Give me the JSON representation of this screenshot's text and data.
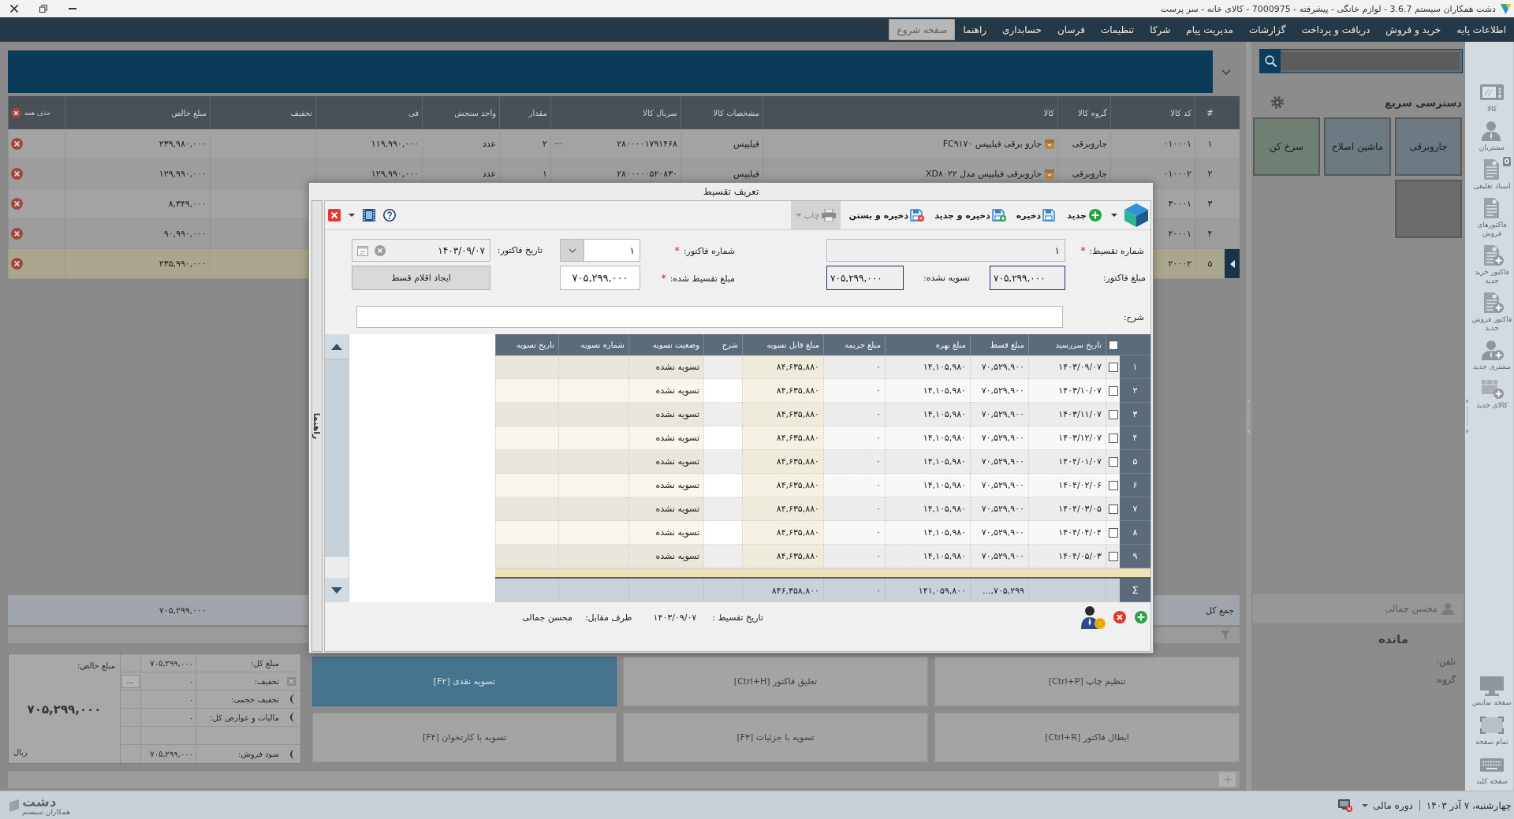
{
  "window": {
    "title": "دشت همکاران سیستم 3.6.7 - لوازم خانگی - پیشرفته - 7000975 - کالای خانه - سر پرست"
  },
  "menu": [
    {
      "label": "اطلاعات پایه",
      "selected": false
    },
    {
      "label": "خرید و فروش",
      "selected": false
    },
    {
      "label": "دریافت و پرداخت",
      "selected": false
    },
    {
      "label": "گزارشات",
      "selected": false
    },
    {
      "label": "مدیریت پیام",
      "selected": false
    },
    {
      "label": "شرکا",
      "selected": false
    },
    {
      "label": "تنظیمات",
      "selected": false
    },
    {
      "label": "فرسان",
      "selected": false
    },
    {
      "label": "حسابداری",
      "selected": false
    },
    {
      "label": "راهنما",
      "selected": false
    },
    {
      "label": "صفحه شروع",
      "selected": true
    }
  ],
  "sidebar": {
    "items": [
      {
        "kind": "product",
        "label": "کالا"
      },
      {
        "kind": "customers",
        "label": "مشتریان"
      },
      {
        "kind": "suspended",
        "label": "اسناد تعلیقی",
        "badge": "0"
      },
      {
        "kind": "invoices",
        "label": "فاکتورهای فروش"
      },
      {
        "kind": "new_purchase",
        "label": "فاکتور خرید جدید"
      },
      {
        "kind": "new_sale",
        "label": "فاکتور فروش جدید"
      },
      {
        "kind": "new_customer",
        "label": "مشتری جدید"
      },
      {
        "kind": "new_product",
        "label": "کالای جدید"
      }
    ],
    "bottom_items": [
      {
        "kind": "display",
        "label": "صفحه نمایش"
      },
      {
        "kind": "fullscreen",
        "label": "تمام صفحه"
      },
      {
        "kind": "keyboard",
        "label": "صفحه کلید"
      }
    ]
  },
  "quick_access": {
    "title": "دسترسی سریع",
    "tiles": [
      {
        "label": "جاروبرقی",
        "color": "#6e7a83"
      },
      {
        "label": "ماشین اصلاح",
        "color": "#6c7a81"
      },
      {
        "label": "سرخ کن",
        "color": "#6f7f74"
      },
      {
        "color": "#6b6b6b"
      }
    ]
  },
  "customer": {
    "name": "محسن جمالی",
    "balance_title": "مانده",
    "phone_label": "تلفن:",
    "group_label": "گروه:"
  },
  "items_table": {
    "columns": [
      "#",
      "کد کالا",
      "گروه کالا",
      "کالا",
      "مشخصات کالا",
      "سریال کالا",
      "مقدار",
      "واحد سنجش",
      "فی",
      "تخفیف",
      "مبلغ خالص",
      "حذف همه"
    ],
    "rows": [
      {
        "index": "۱",
        "code": "۰۱۰۰۰۱",
        "group": "جاروبرقی",
        "product": "جارو برقی فیلیپس FC۹۱۷۰",
        "brand": "فیلیپس",
        "serial": "۲۸۰۰۰۰۱۷۹۱۴۶۸",
        "more": "...",
        "qty": "۲",
        "unit": "عدد",
        "price": "۱۱۹,۹۹۰,۰۰۰",
        "net": "۲۳۹,۹۸۰,۰۰۰",
        "selected": false
      },
      {
        "index": "۲",
        "code": "۰۱۰۰۰۲",
        "group": "جاروبرقی",
        "product": "جاروبرقی فیلیپس مدل XD۸۰۲۲",
        "brand": "فیلیپس",
        "serial": "۲۸۰۰۰۰۰۵۲۰۸۳۰",
        "qty": "۱",
        "unit": "عدد",
        "price": "۱۲۹,۹۹۰,۰۰۰",
        "net": "۱۲۹,۹۹۰,۰۰۰",
        "selected": false
      },
      {
        "index": "۳",
        "code": "۳۰۰۰۱",
        "net": "۸,۳۴۹,۰۰۰",
        "selected": false
      },
      {
        "index": "۴",
        "code": "۲۰۰۰۱",
        "net": "۹۰,۹۹۰,۰۰۰",
        "selected": false
      },
      {
        "index": "۵",
        "code": "۲۰۰۰۲",
        "net": "۲۳۵,۹۹۰,۰۰۰",
        "selected": true
      }
    ],
    "total_label": "جمع کل",
    "total_value": "۷۰۵,۲۹۹,۰۰۰"
  },
  "actions": [
    {
      "label": "تنظیم چاپ [Ctrl+P]",
      "kind": "normal"
    },
    {
      "label": "تعلیق فاکتور [Ctrl+H]",
      "kind": "normal"
    },
    {
      "label": "تسویه نقدی [F۲]",
      "kind": "primary"
    },
    {
      "label": "ابطال فاکتور [Ctrl+R]",
      "kind": "normal"
    },
    {
      "label": "تسویه با جزئیات [F۳]",
      "kind": "normal"
    },
    {
      "label": "تسویه با کارتخوان [F۴]",
      "kind": "normal"
    }
  ],
  "summary": {
    "net_label": "مبلغ خالص:",
    "net_value": "۷۰۵,۲۹۹,۰۰۰",
    "currency": "ریال",
    "rows": [
      {
        "kind": "plain",
        "label": "مبلغ کل:",
        "value": "۷۰۵,۲۹۹,۰۰۰"
      },
      {
        "kind": "discount",
        "label": "تخفیف:",
        "value": "۰",
        "more": "..."
      },
      {
        "kind": "toggle",
        "label": "تخفیف حجمی:",
        "value": "۰"
      },
      {
        "kind": "toggle",
        "label": "مالیات و عوارض کل:",
        "value": "۰"
      },
      {
        "kind": "blank"
      },
      {
        "kind": "toggle",
        "label": "سود فروش:",
        "value": "۷۰۵,۲۹۹,۰۰۰"
      }
    ]
  },
  "status_bar": {
    "date": "چهارشنبه، ۷ آذر ۱۴۰۳",
    "fiscal_period": "دوره مالی",
    "brand": "دشت",
    "brand_tagline": "همکاران سیستم"
  },
  "installment_dialog": {
    "title": "تعریف تقسیط",
    "side_tab": "راهنما",
    "toolbar": [
      {
        "kind": "new",
        "label": "جدید",
        "disabled": false
      },
      {
        "kind": "save",
        "label": "ذخیره",
        "disabled": false
      },
      {
        "kind": "save_new",
        "label": "ذخیره و جدید",
        "disabled": false
      },
      {
        "kind": "save_close",
        "label": "ذخیره و بستن",
        "disabled": false
      },
      {
        "kind": "print",
        "label": "چاپ",
        "disabled": true
      }
    ],
    "form": {
      "installment_no": {
        "kind": "text",
        "label": "شماره تقسیط:",
        "required_mark": "*",
        "value": "۱",
        "disabled": true
      },
      "invoice_no": {
        "kind": "combo",
        "label": "شماره فاکتور:",
        "required_mark": "*",
        "value": "۱",
        "disabled": false
      },
      "invoice_date": {
        "kind": "date",
        "label": "تاریخ فاکتور:",
        "value": "۱۴۰۳/۰۹/۰۷",
        "disabled": true
      },
      "invoice_amount": {
        "kind": "readout",
        "label": "مبلغ فاکتور:",
        "value": "۷۰۵,۲۹۹,۰۰۰",
        "disabled": true
      },
      "unsettled": {
        "kind": "readout",
        "label": "تسویه نشده:",
        "value": "۷۰۵,۲۹۹,۰۰۰",
        "disabled": true
      },
      "installment_amount": {
        "kind": "amount",
        "label": "مبلغ تقسیط شده:",
        "required_mark": "*",
        "value": "۷۰۵,۲۹۹,۰۰۰",
        "disabled": false
      },
      "description": {
        "kind": "text",
        "label": "شرح:",
        "disabled": false
      },
      "create_button": "ایجاد اقلام قسط"
    },
    "grid": {
      "columns": [
        "تاریخ سررسید",
        "مبلغ قسط",
        "مبلغ بهره",
        "مبلغ جریمه",
        "مبلغ قابل تسویه",
        "شرح",
        "وضعیت تسویه",
        "شماره تسویه",
        "تاریخ تسویه"
      ],
      "header_checked": false,
      "rows": [
        {
          "index": "۱",
          "checked": false,
          "due_date": "۱۴۰۳/۰۹/۰۷",
          "amount": "۷۰,۵۲۹,۹۰۰",
          "interest": "۱۴,۱۰۵,۹۸۰",
          "penalty": "۰",
          "payable": "۸۴,۶۳۵,۸۸۰",
          "status": "تسویه نشده"
        },
        {
          "index": "۲",
          "checked": false,
          "due_date": "۱۴۰۳/۱۰/۰۷",
          "amount": "۷۰,۵۲۹,۹۰۰",
          "interest": "۱۴,۱۰۵,۹۸۰",
          "penalty": "۰",
          "payable": "۸۴,۶۳۵,۸۸۰",
          "status": "تسویه نشده"
        },
        {
          "index": "۳",
          "checked": false,
          "due_date": "۱۴۰۳/۱۱/۰۷",
          "amount": "۷۰,۵۲۹,۹۰۰",
          "interest": "۱۴,۱۰۵,۹۸۰",
          "penalty": "۰",
          "payable": "۸۴,۶۳۵,۸۸۰",
          "status": "تسویه نشده"
        },
        {
          "index": "۴",
          "checked": false,
          "due_date": "۱۴۰۳/۱۲/۰۷",
          "amount": "۷۰,۵۲۹,۹۰۰",
          "interest": "۱۴,۱۰۵,۹۸۰",
          "penalty": "۰",
          "payable": "۸۴,۶۳۵,۸۸۰",
          "status": "تسویه نشده"
        },
        {
          "index": "۵",
          "checked": false,
          "due_date": "۱۴۰۴/۰۱/۰۷",
          "amount": "۷۰,۵۲۹,۹۰۰",
          "interest": "۱۴,۱۰۵,۹۸۰",
          "penalty": "۰",
          "payable": "۸۴,۶۳۵,۸۸۰",
          "status": "تسویه نشده"
        },
        {
          "index": "۶",
          "checked": false,
          "due_date": "۱۴۰۴/۰۲/۰۶",
          "amount": "۷۰,۵۲۹,۹۰۰",
          "interest": "۱۴,۱۰۵,۹۸۰",
          "penalty": "۰",
          "payable": "۸۴,۶۳۵,۸۸۰",
          "status": "تسویه نشده"
        },
        {
          "index": "۷",
          "checked": false,
          "due_date": "۱۴۰۴/۰۳/۰۵",
          "amount": "۷۰,۵۲۹,۹۰۰",
          "interest": "۱۴,۱۰۵,۹۸۰",
          "penalty": "۰",
          "payable": "۸۴,۶۳۵,۸۸۰",
          "status": "تسویه نشده"
        },
        {
          "index": "۸",
          "checked": false,
          "due_date": "۱۴۰۴/۰۴/۰۴",
          "amount": "۷۰,۵۲۹,۹۰۰",
          "interest": "۱۴,۱۰۵,۹۸۰",
          "penalty": "۰",
          "payable": "۸۴,۶۳۵,۸۸۰",
          "status": "تسویه نشده"
        },
        {
          "index": "۹",
          "checked": false,
          "due_date": "۱۴۰۴/۰۵/۰۳",
          "amount": "۷۰,۵۲۹,۹۰۰",
          "interest": "۱۴,۱۰۵,۹۸۰",
          "penalty": "۰",
          "payable": "۸۴,۶۳۵,۸۸۰",
          "status": "تسویه نشده"
        }
      ],
      "totals": {
        "symbol": "Σ",
        "amount": "۷۰۵,۲۹۹,...",
        "interest": "۱۴۱,۰۵۹,۸۰۰",
        "penalty": "۰",
        "payable": "۸۴۶,۳۵۸,۸۰۰"
      }
    },
    "footer": {
      "date_label": "تاریخ تقسیط :",
      "date": "۱۴۰۳/۰۹/۰۷",
      "party_label": "طرف مقابل:",
      "party": "محسن جمالی"
    }
  }
}
